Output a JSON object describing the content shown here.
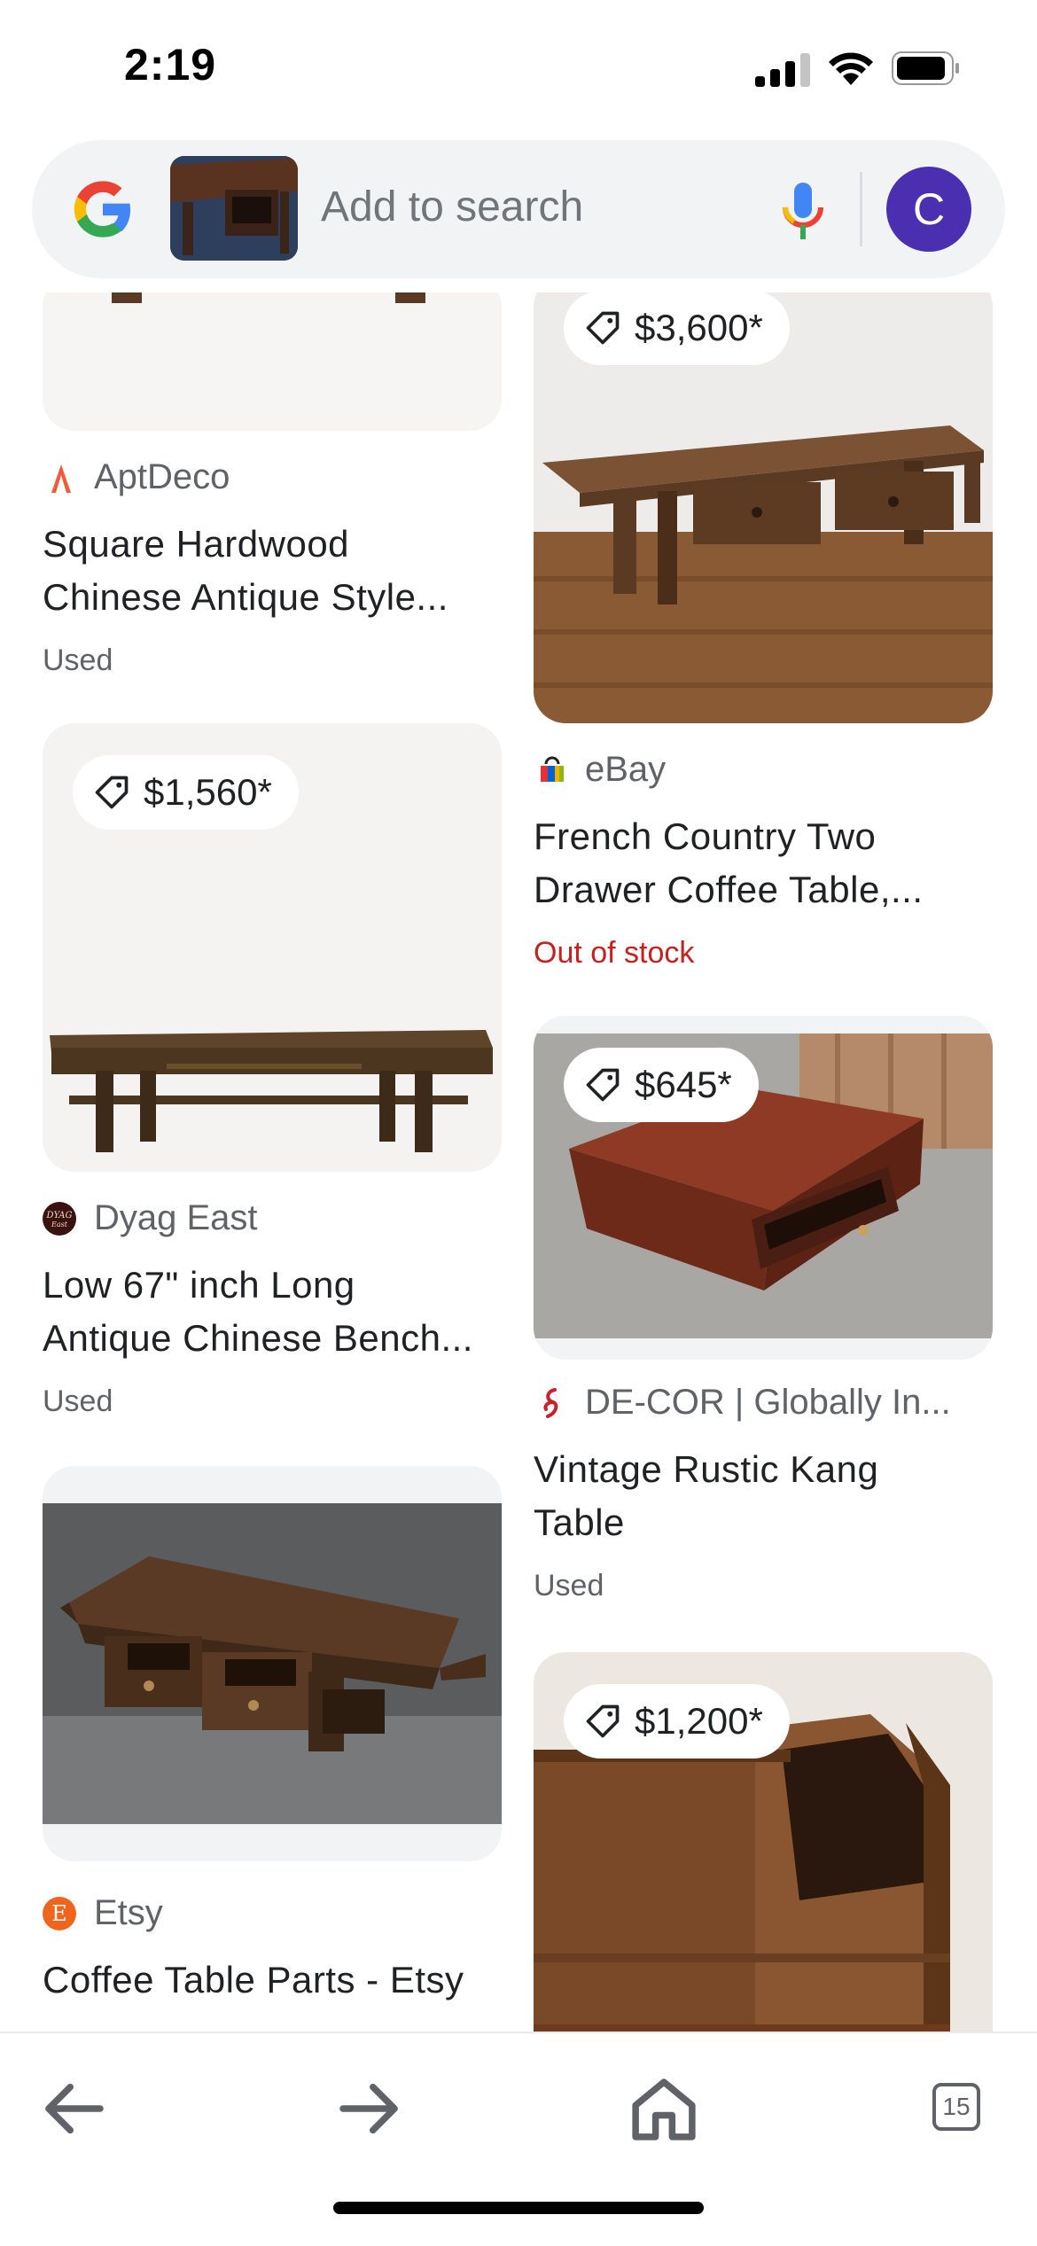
{
  "status_bar": {
    "time": "2:19"
  },
  "search_bar": {
    "placeholder": "Add to search",
    "avatar_letter": "C"
  },
  "results": [
    {
      "source": "AptDeco",
      "title_line1": "Square Hardwood",
      "title_line2": "Chinese Antique Style...",
      "condition": "Used"
    },
    {
      "price": "$3,600*",
      "source": "eBay",
      "title_line1": "French Country Two",
      "title_line2": "Drawer Coffee Table,...",
      "condition": "Out of stock"
    },
    {
      "price": "$1,560*",
      "source": "Dyag East",
      "title_line1": "Low 67\" inch Long",
      "title_line2": "Antique Chinese Bench...",
      "condition": "Used"
    },
    {
      "price": "$645*",
      "source": "DE-COR | Globally In...",
      "title_line1": "Vintage Rustic Kang",
      "title_line2": "Table",
      "condition": "Used"
    },
    {
      "source": "Etsy",
      "title_line1": "Coffee Table Parts - Etsy"
    },
    {
      "price": "$1,200*"
    }
  ],
  "bottom_nav": {
    "tab_count": "15"
  },
  "icons": [
    "google-logo-icon",
    "microphone-icon",
    "price-tag-icon",
    "back-arrow-icon",
    "forward-arrow-icon",
    "home-icon",
    "tabs-icon"
  ],
  "colors": {
    "out_of_stock": "#c5221f",
    "avatar": "#4a2fb0",
    "search_bg": "#f1f3f4"
  }
}
